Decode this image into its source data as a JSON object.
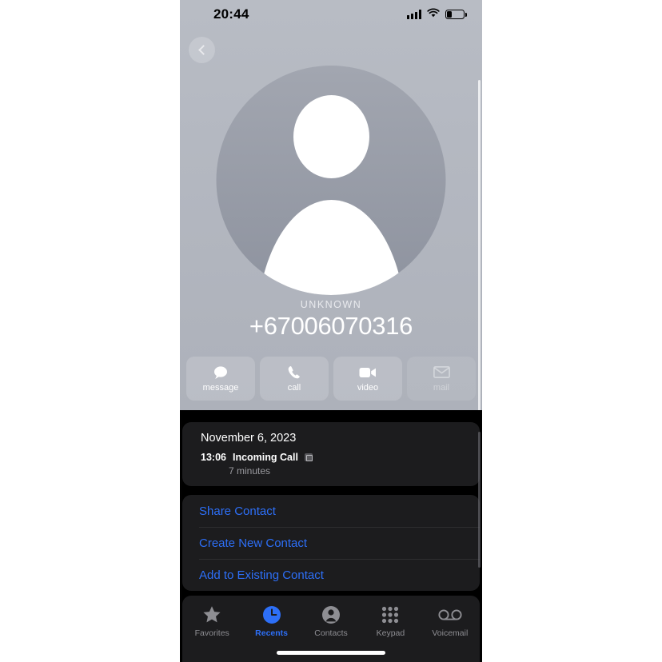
{
  "status_bar": {
    "time": "20:44",
    "signal_icon": "cellular-bars-icon",
    "wifi_icon": "wifi-icon",
    "battery_icon": "battery-low-icon",
    "battery_percent": 25
  },
  "nav": {
    "back_icon": "chevron-left-icon",
    "back_label": ""
  },
  "contact": {
    "avatar_icon": "person-placeholder-avatar",
    "name_label": "UNKNOWN",
    "phone_number": "+67006070316"
  },
  "actions": [
    {
      "id": "message",
      "label": "message",
      "icon": "message-bubble-icon",
      "disabled": false
    },
    {
      "id": "call",
      "label": "call",
      "icon": "phone-handset-icon",
      "disabled": false
    },
    {
      "id": "video",
      "label": "video",
      "icon": "video-camera-icon",
      "disabled": false
    },
    {
      "id": "mail",
      "label": "mail",
      "icon": "envelope-icon",
      "disabled": true
    }
  ],
  "call_history": {
    "date": "November 6, 2023",
    "time": "13:06",
    "type": "Incoming Call",
    "sim_icon": "sim-card-icon",
    "duration": "7 minutes"
  },
  "menu": [
    {
      "id": "share-contact",
      "label": "Share Contact"
    },
    {
      "id": "create-new-contact",
      "label": "Create New Contact"
    },
    {
      "id": "add-to-existing",
      "label": "Add to Existing Contact"
    }
  ],
  "tabbar": {
    "items": [
      {
        "id": "favorites",
        "label": "Favorites",
        "icon": "star-icon",
        "active": false
      },
      {
        "id": "recents",
        "label": "Recents",
        "icon": "clock-icon",
        "active": true
      },
      {
        "id": "contacts",
        "label": "Contacts",
        "icon": "person-icon",
        "active": false
      },
      {
        "id": "keypad",
        "label": "Keypad",
        "icon": "keypad-dots-icon",
        "active": false
      },
      {
        "id": "voicemail",
        "label": "Voicemail",
        "icon": "voicemail-icon",
        "active": false
      }
    ]
  },
  "colors": {
    "accent_blue": "#2d6ff7",
    "card_dark": "#1c1c1e",
    "panel_grey": "#b3b7c0",
    "inactive_grey": "#8e8e93"
  }
}
